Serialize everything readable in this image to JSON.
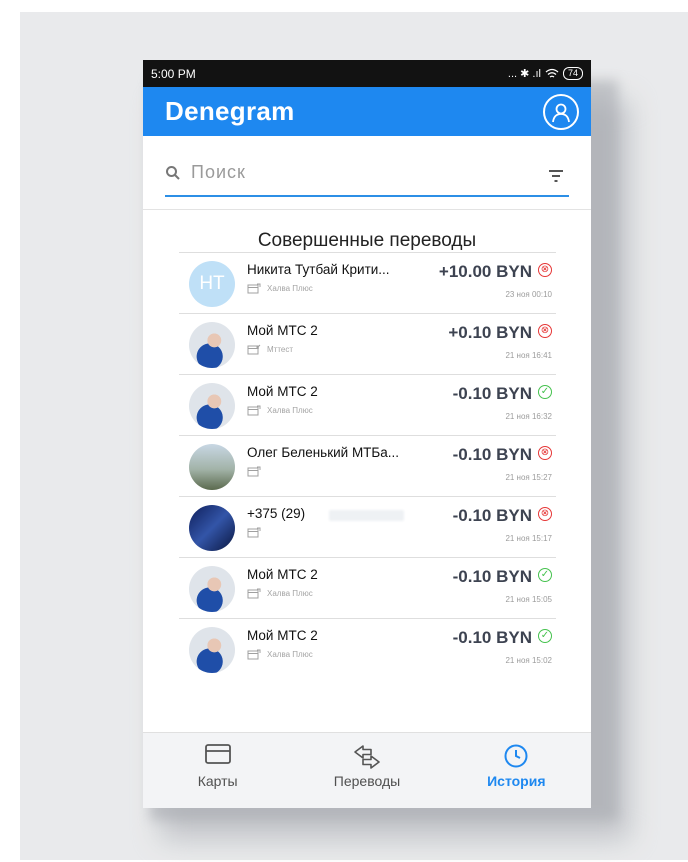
{
  "status_bar": {
    "time": "5:00 PM",
    "indicators": "... ✱ .ıl",
    "battery": "74"
  },
  "app_bar": {
    "title": "Denegram",
    "profile_icon": "user-circle-icon"
  },
  "search": {
    "placeholder": "Поиск",
    "search_icon": "search-icon",
    "filter_icon": "filter-icon"
  },
  "section_title": "Совершенные переводы",
  "transactions": [
    {
      "avatar": "НТ",
      "name": "Никита Тутбай Крити...",
      "card": "Халва Плюс",
      "amount": "+10.00 BYN",
      "status": "failed",
      "status_icon": "⊗",
      "date": "23 ноя 00:10"
    },
    {
      "avatar": "",
      "name": "Мой МТС 2",
      "card": "Мттест",
      "amount": "+0.10 BYN",
      "status": "failed",
      "status_icon": "⊗",
      "date": "21 ноя 16:41"
    },
    {
      "avatar": "",
      "name": "Мой МТС 2",
      "card": "Халва Плюс",
      "amount": "-0.10 BYN",
      "status": "success",
      "status_icon": "✓",
      "date": "21 ноя 16:32"
    },
    {
      "avatar": "",
      "name": "Олег Беленький МТБа...",
      "card": "",
      "amount": "-0.10 BYN",
      "status": "failed",
      "status_icon": "⊗",
      "date": "21 ноя 15:27"
    },
    {
      "avatar": "",
      "name": "+375 (29)",
      "card": "",
      "amount": "-0.10 BYN",
      "status": "failed",
      "status_icon": "⊗",
      "date": "21 ноя 15:17"
    },
    {
      "avatar": "",
      "name": "Мой МТС 2",
      "card": "Халва Плюс",
      "amount": "-0.10 BYN",
      "status": "success",
      "status_icon": "✓",
      "date": "21 ноя 15:05"
    },
    {
      "avatar": "",
      "name": "Мой МТС 2",
      "card": "Халва Плюс",
      "amount": "-0.10 BYN",
      "status": "success",
      "status_icon": "✓",
      "date": "21 ноя 15:02"
    }
  ],
  "tabs": [
    {
      "label": "Карты",
      "icon": "card-icon",
      "active": false
    },
    {
      "label": "Переводы",
      "icon": "transfer-arrows-icon",
      "active": false
    },
    {
      "label": "История",
      "icon": "clock-icon",
      "active": true
    }
  ],
  "colors": {
    "accent": "#1e88f0",
    "success": "#45c24e",
    "fail": "#e63737"
  }
}
